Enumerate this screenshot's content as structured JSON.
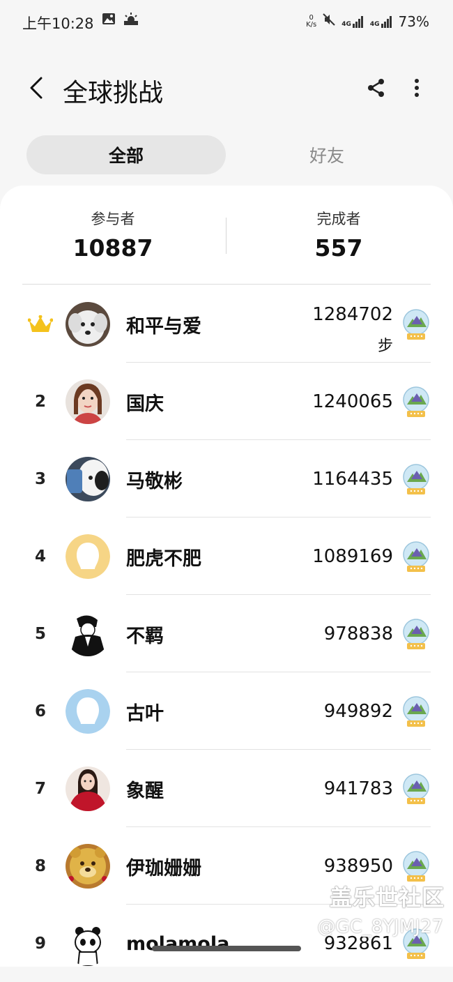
{
  "status_bar": {
    "time": "上午10:28",
    "net_speed_top": "0",
    "net_speed_unit": "K/s",
    "network_1": "4G",
    "network_2": "4G",
    "battery": "73%"
  },
  "header": {
    "title": "全球挑战"
  },
  "tabs": [
    {
      "label": "全部",
      "active": true
    },
    {
      "label": "好友",
      "active": false
    }
  ],
  "stats": {
    "participants_label": "参与者",
    "participants_value": "10887",
    "finishers_label": "完成者",
    "finishers_value": "557"
  },
  "leaderboard": [
    {
      "rank": "",
      "rank_icon": "crown-icon",
      "name": "和平与爱",
      "steps": "1284702",
      "unit": "步",
      "avatar": "dog-photo"
    },
    {
      "rank": "2",
      "name": "国庆",
      "steps": "1240065",
      "avatar": "woman-photo"
    },
    {
      "rank": "3",
      "name": "马敬彬",
      "steps": "1164435",
      "avatar": "animal-photo"
    },
    {
      "rank": "4",
      "name": "肥虎不肥",
      "steps": "1089169",
      "avatar": "default-avatar-yellow"
    },
    {
      "rank": "5",
      "name": "不羁",
      "steps": "978838",
      "avatar": "sketch-man"
    },
    {
      "rank": "6",
      "name": "古叶",
      "steps": "949892",
      "avatar": "default-avatar-blue"
    },
    {
      "rank": "7",
      "name": "象醒",
      "steps": "941783",
      "avatar": "woman-red-dress"
    },
    {
      "rank": "8",
      "name": "伊珈姗姗",
      "steps": "938950",
      "avatar": "bear-cake"
    },
    {
      "rank": "9",
      "name": "molamola",
      "steps": "932861",
      "avatar": "panda-drawing"
    }
  ],
  "watermark": {
    "line1": "盖乐世社区",
    "line2": "@GC_8YJMJ27"
  },
  "colors": {
    "crown": "#f4c21c",
    "tab_active_bg": "#e6e6e6",
    "card_bg": "#ffffff",
    "page_bg": "#f6f6f6"
  }
}
